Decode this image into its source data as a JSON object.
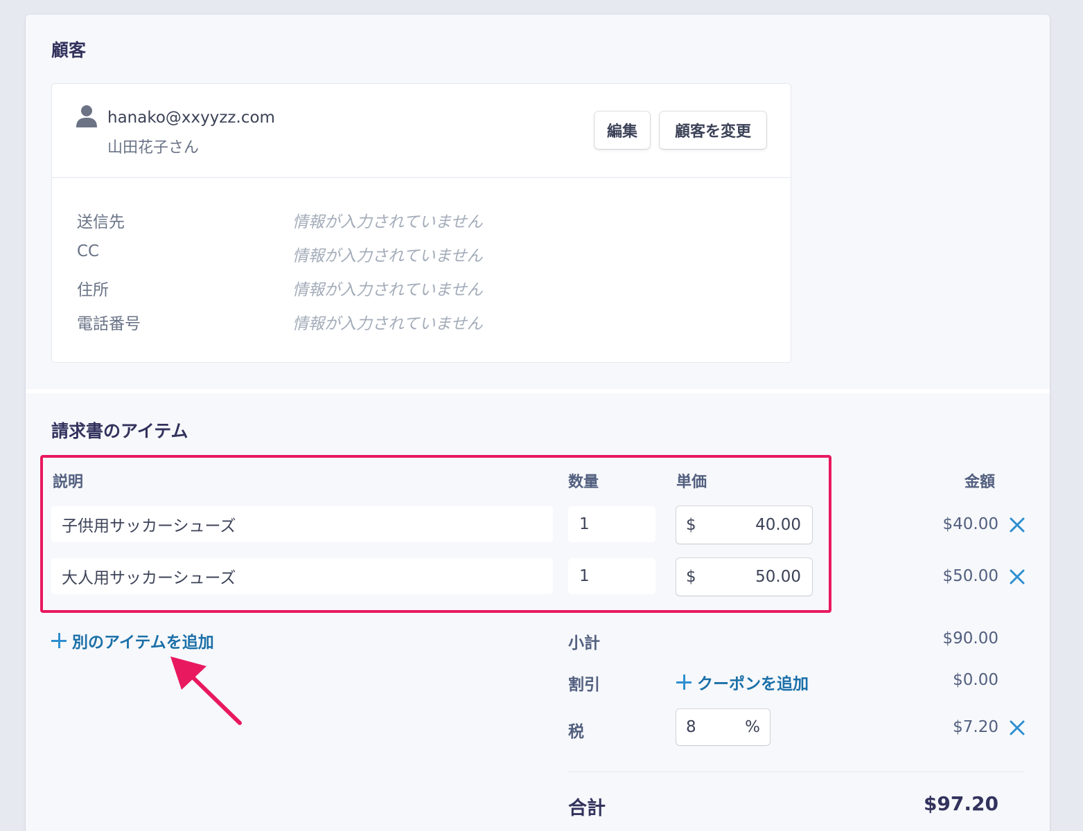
{
  "customer_section": {
    "title": "顧客",
    "email": "hanako@xxyyzz.com",
    "name": "山田花子さん",
    "edit_button": "編集",
    "change_button": "顧客を変更",
    "fields": [
      {
        "label": "送信先",
        "value": "情報が入力されていません"
      },
      {
        "label": "CC",
        "value": "情報が入力されていません"
      },
      {
        "label": "住所",
        "value": "情報が入力されていません"
      },
      {
        "label": "電話番号",
        "value": "情報が入力されていません"
      }
    ]
  },
  "items_section": {
    "title": "請求書のアイテム",
    "columns": {
      "description": "説明",
      "quantity": "数量",
      "unit_price": "単価",
      "amount": "金額"
    },
    "items": [
      {
        "description": "子供用サッカーシューズ",
        "quantity": "1",
        "currency": "$",
        "unit_price": "40.00",
        "amount": "$40.00"
      },
      {
        "description": "大人用サッカーシューズ",
        "quantity": "1",
        "currency": "$",
        "unit_price": "50.00",
        "amount": "$50.00"
      }
    ],
    "add_item_link": "別のアイテムを追加"
  },
  "summary": {
    "subtotal_label": "小計",
    "subtotal": "$90.00",
    "discount_label": "割引",
    "add_coupon_link": "クーポンを追加",
    "discount": "$0.00",
    "tax_label": "税",
    "tax_rate": "8",
    "tax_unit": "%",
    "tax": "$7.20",
    "total_label": "合計",
    "total": "$97.20"
  },
  "colors": {
    "highlight": "#e8195f",
    "link": "#1a6fa8",
    "remove_icon": "#2d8fd0"
  },
  "icons": [
    "person-icon",
    "remove-item-icon",
    "plus-icon",
    "arrow-annotation"
  ]
}
